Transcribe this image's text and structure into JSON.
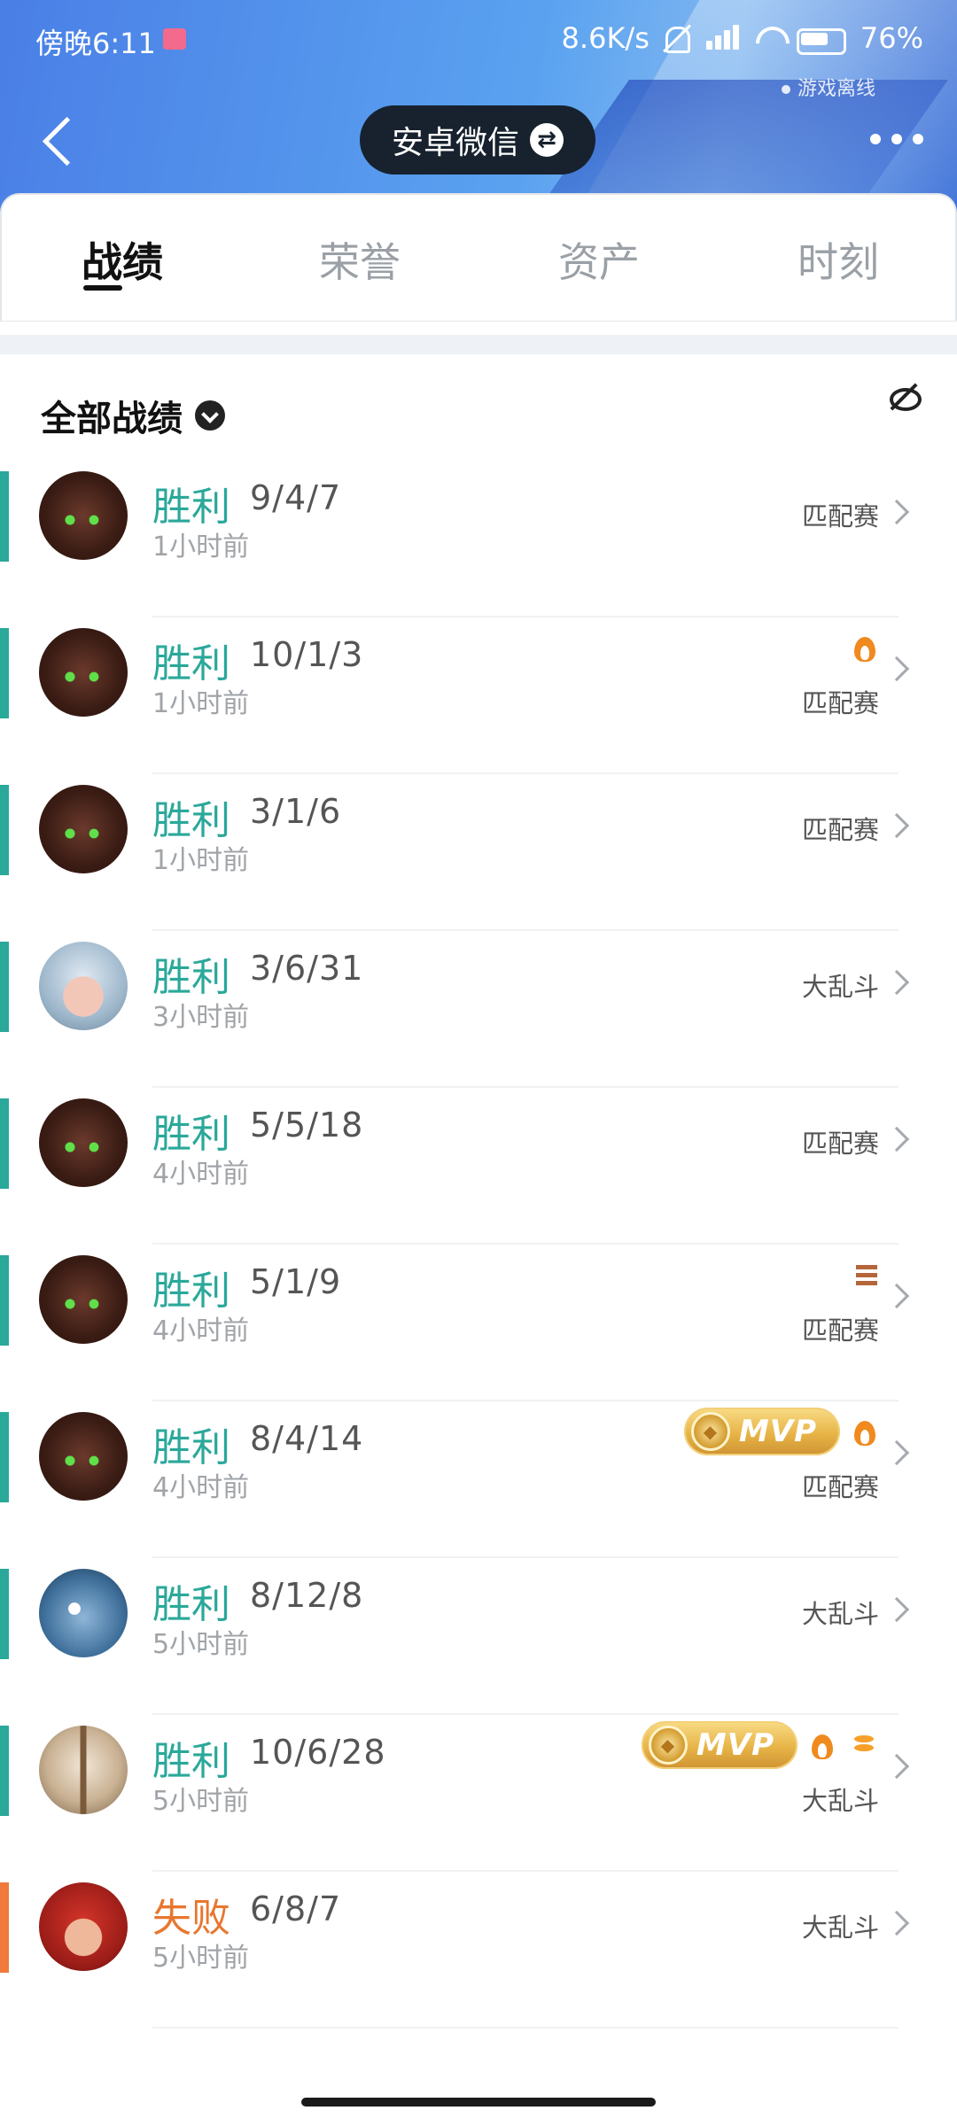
{
  "status_bar": {
    "time": "傍晚6:11",
    "net_speed": "8.6K/s",
    "battery": "76%",
    "game_status": "游戏离线"
  },
  "nav": {
    "account_label": "安卓微信"
  },
  "tabs": [
    {
      "label": "战绩",
      "active": true
    },
    {
      "label": "荣誉",
      "active": false
    },
    {
      "label": "资产",
      "active": false
    },
    {
      "label": "时刻",
      "active": false
    }
  ],
  "filter": {
    "label": "全部战绩"
  },
  "matches": [
    {
      "result": "胜利",
      "kda": "9/4/7",
      "time": "1小时前",
      "mode": "匹配赛",
      "outcome": "win",
      "avatar": "hero-cyborg",
      "badges": []
    },
    {
      "result": "胜利",
      "kda": "10/1/3",
      "time": "1小时前",
      "mode": "匹配赛",
      "outcome": "win",
      "avatar": "hero-cyborg",
      "badges": [
        "flame"
      ]
    },
    {
      "result": "胜利",
      "kda": "3/1/6",
      "time": "1小时前",
      "mode": "匹配赛",
      "outcome": "win",
      "avatar": "hero-cyborg",
      "badges": []
    },
    {
      "result": "胜利",
      "kda": "3/6/31",
      "time": "3小时前",
      "mode": "大乱斗",
      "outcome": "win",
      "avatar": "hero-white-hair",
      "badges": []
    },
    {
      "result": "胜利",
      "kda": "5/5/18",
      "time": "4小时前",
      "mode": "匹配赛",
      "outcome": "win",
      "avatar": "hero-cyborg",
      "badges": []
    },
    {
      "result": "胜利",
      "kda": "5/1/9",
      "time": "4小时前",
      "mode": "匹配赛",
      "outcome": "win",
      "avatar": "hero-cyborg",
      "badges": [
        "triple"
      ]
    },
    {
      "result": "胜利",
      "kda": "8/4/14",
      "time": "4小时前",
      "mode": "匹配赛",
      "outcome": "win",
      "avatar": "hero-cyborg",
      "badges": [
        "mvp",
        "flame"
      ]
    },
    {
      "result": "胜利",
      "kda": "8/12/8",
      "time": "5小时前",
      "mode": "大乱斗",
      "outcome": "win",
      "avatar": "hero-fish",
      "badges": []
    },
    {
      "result": "胜利",
      "kda": "10/6/28",
      "time": "5小时前",
      "mode": "大乱斗",
      "outcome": "win",
      "avatar": "hero-helmet",
      "badges": [
        "mvp",
        "flame",
        "coins"
      ]
    },
    {
      "result": "失败",
      "kda": "6/8/7",
      "time": "5小时前",
      "mode": "大乱斗",
      "outcome": "loss",
      "avatar": "hero-red-hair",
      "badges": []
    }
  ],
  "mvp_label": "MVP",
  "colors": {
    "win": "#2aa89a",
    "loss": "#e8772e",
    "header_blue": "#4a7fe6"
  }
}
